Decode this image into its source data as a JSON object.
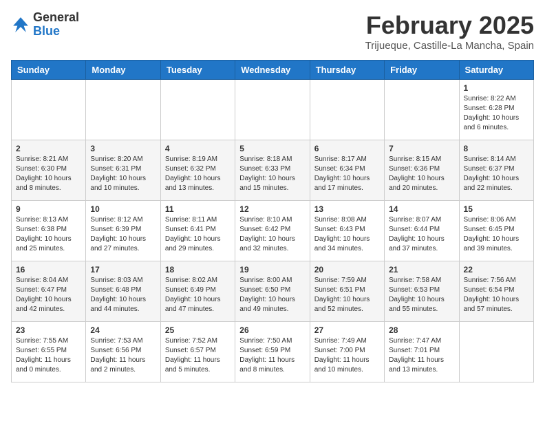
{
  "header": {
    "logo_general": "General",
    "logo_blue": "Blue",
    "month_title": "February 2025",
    "location": "Trijueque, Castille-La Mancha, Spain"
  },
  "days_of_week": [
    "Sunday",
    "Monday",
    "Tuesday",
    "Wednesday",
    "Thursday",
    "Friday",
    "Saturday"
  ],
  "weeks": [
    [
      {
        "day": "",
        "info": ""
      },
      {
        "day": "",
        "info": ""
      },
      {
        "day": "",
        "info": ""
      },
      {
        "day": "",
        "info": ""
      },
      {
        "day": "",
        "info": ""
      },
      {
        "day": "",
        "info": ""
      },
      {
        "day": "1",
        "info": "Sunrise: 8:22 AM\nSunset: 6:28 PM\nDaylight: 10 hours and 6 minutes."
      }
    ],
    [
      {
        "day": "2",
        "info": "Sunrise: 8:21 AM\nSunset: 6:30 PM\nDaylight: 10 hours and 8 minutes."
      },
      {
        "day": "3",
        "info": "Sunrise: 8:20 AM\nSunset: 6:31 PM\nDaylight: 10 hours and 10 minutes."
      },
      {
        "day": "4",
        "info": "Sunrise: 8:19 AM\nSunset: 6:32 PM\nDaylight: 10 hours and 13 minutes."
      },
      {
        "day": "5",
        "info": "Sunrise: 8:18 AM\nSunset: 6:33 PM\nDaylight: 10 hours and 15 minutes."
      },
      {
        "day": "6",
        "info": "Sunrise: 8:17 AM\nSunset: 6:34 PM\nDaylight: 10 hours and 17 minutes."
      },
      {
        "day": "7",
        "info": "Sunrise: 8:15 AM\nSunset: 6:36 PM\nDaylight: 10 hours and 20 minutes."
      },
      {
        "day": "8",
        "info": "Sunrise: 8:14 AM\nSunset: 6:37 PM\nDaylight: 10 hours and 22 minutes."
      }
    ],
    [
      {
        "day": "9",
        "info": "Sunrise: 8:13 AM\nSunset: 6:38 PM\nDaylight: 10 hours and 25 minutes."
      },
      {
        "day": "10",
        "info": "Sunrise: 8:12 AM\nSunset: 6:39 PM\nDaylight: 10 hours and 27 minutes."
      },
      {
        "day": "11",
        "info": "Sunrise: 8:11 AM\nSunset: 6:41 PM\nDaylight: 10 hours and 29 minutes."
      },
      {
        "day": "12",
        "info": "Sunrise: 8:10 AM\nSunset: 6:42 PM\nDaylight: 10 hours and 32 minutes."
      },
      {
        "day": "13",
        "info": "Sunrise: 8:08 AM\nSunset: 6:43 PM\nDaylight: 10 hours and 34 minutes."
      },
      {
        "day": "14",
        "info": "Sunrise: 8:07 AM\nSunset: 6:44 PM\nDaylight: 10 hours and 37 minutes."
      },
      {
        "day": "15",
        "info": "Sunrise: 8:06 AM\nSunset: 6:45 PM\nDaylight: 10 hours and 39 minutes."
      }
    ],
    [
      {
        "day": "16",
        "info": "Sunrise: 8:04 AM\nSunset: 6:47 PM\nDaylight: 10 hours and 42 minutes."
      },
      {
        "day": "17",
        "info": "Sunrise: 8:03 AM\nSunset: 6:48 PM\nDaylight: 10 hours and 44 minutes."
      },
      {
        "day": "18",
        "info": "Sunrise: 8:02 AM\nSunset: 6:49 PM\nDaylight: 10 hours and 47 minutes."
      },
      {
        "day": "19",
        "info": "Sunrise: 8:00 AM\nSunset: 6:50 PM\nDaylight: 10 hours and 49 minutes."
      },
      {
        "day": "20",
        "info": "Sunrise: 7:59 AM\nSunset: 6:51 PM\nDaylight: 10 hours and 52 minutes."
      },
      {
        "day": "21",
        "info": "Sunrise: 7:58 AM\nSunset: 6:53 PM\nDaylight: 10 hours and 55 minutes."
      },
      {
        "day": "22",
        "info": "Sunrise: 7:56 AM\nSunset: 6:54 PM\nDaylight: 10 hours and 57 minutes."
      }
    ],
    [
      {
        "day": "23",
        "info": "Sunrise: 7:55 AM\nSunset: 6:55 PM\nDaylight: 11 hours and 0 minutes."
      },
      {
        "day": "24",
        "info": "Sunrise: 7:53 AM\nSunset: 6:56 PM\nDaylight: 11 hours and 2 minutes."
      },
      {
        "day": "25",
        "info": "Sunrise: 7:52 AM\nSunset: 6:57 PM\nDaylight: 11 hours and 5 minutes."
      },
      {
        "day": "26",
        "info": "Sunrise: 7:50 AM\nSunset: 6:59 PM\nDaylight: 11 hours and 8 minutes."
      },
      {
        "day": "27",
        "info": "Sunrise: 7:49 AM\nSunset: 7:00 PM\nDaylight: 11 hours and 10 minutes."
      },
      {
        "day": "28",
        "info": "Sunrise: 7:47 AM\nSunset: 7:01 PM\nDaylight: 11 hours and 13 minutes."
      },
      {
        "day": "",
        "info": ""
      }
    ]
  ]
}
